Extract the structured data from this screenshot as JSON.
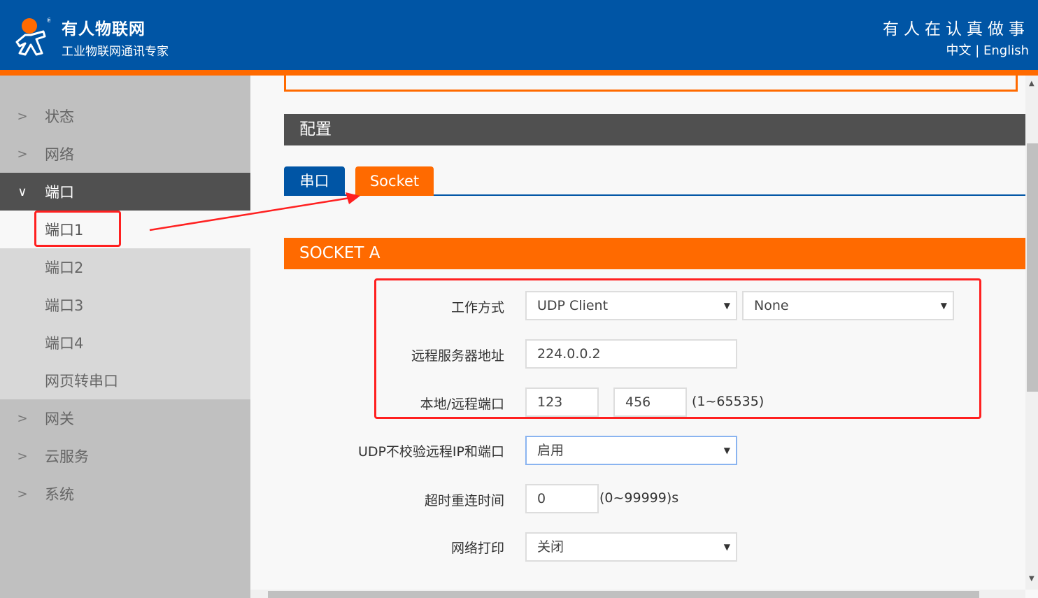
{
  "header": {
    "brand": "有人物联网",
    "subtitle": "工业物联网通讯专家",
    "slogan": "有人在认真做事",
    "lang_zh": "中文",
    "lang_sep": "|",
    "lang_en": "English"
  },
  "sidebar": {
    "items": [
      {
        "label": "状态"
      },
      {
        "label": "网络"
      },
      {
        "label": "端口"
      },
      {
        "label": "端口1"
      },
      {
        "label": "端口2"
      },
      {
        "label": "端口3"
      },
      {
        "label": "端口4"
      },
      {
        "label": "网页转串口"
      },
      {
        "label": "网关"
      },
      {
        "label": "云服务"
      },
      {
        "label": "系统"
      }
    ]
  },
  "main": {
    "config_title": "配置",
    "tabs": [
      {
        "label": "串口"
      },
      {
        "label": "Socket"
      }
    ],
    "section_title": "SOCKET A",
    "form": {
      "work_mode_label": "工作方式",
      "work_mode": "UDP Client",
      "work_mode2": "None",
      "server_label": "远程服务器地址",
      "server": "224.0.0.2",
      "port_label": "本地/远程端口",
      "local_port": "123",
      "remote_port": "456",
      "port_hint": "(1~65535)",
      "udp_check_label": "UDP不校验远程IP和端口",
      "udp_check": "启用",
      "timeout_label": "超时重连时间",
      "timeout": "0",
      "timeout_hint": "(0~99999)s",
      "netprint_label": "网络打印",
      "netprint": "关闭"
    }
  },
  "colors": {
    "header": "#0055a5",
    "accent": "#ff6a00",
    "annotation": "#ff2020"
  }
}
